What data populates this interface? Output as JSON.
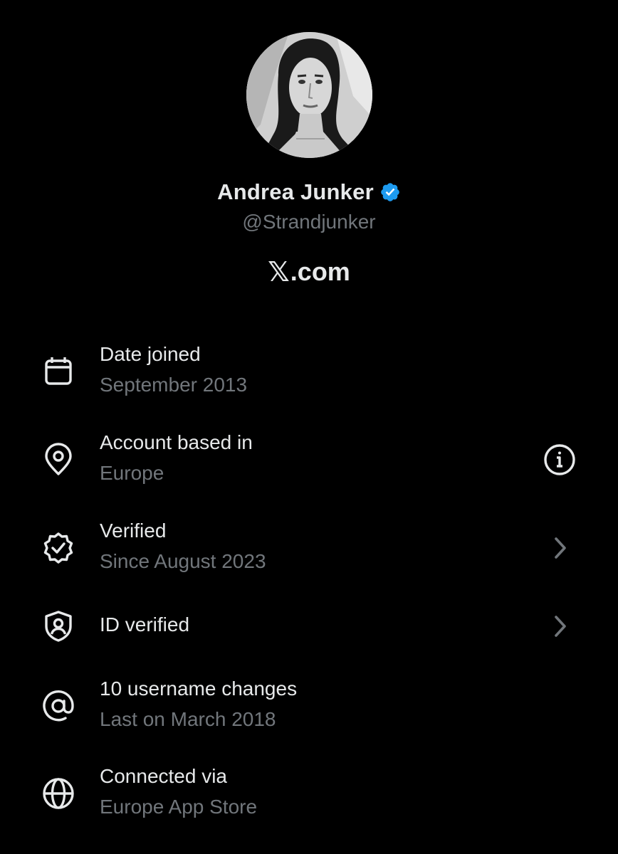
{
  "profile": {
    "display_name": "Andrea Junker",
    "handle": "@Strandjunker",
    "site_glyph": "𝕏",
    "site_suffix": ".com",
    "verified_badge_color": "#1d9bf0"
  },
  "about_rows": [
    {
      "icon": "calendar-icon",
      "title": "Date joined",
      "subtitle": "September 2013"
    },
    {
      "icon": "location-pin-icon",
      "title": "Account based in",
      "subtitle": "Europe",
      "trailing": "info-icon"
    },
    {
      "icon": "verified-seal-icon",
      "title": "Verified",
      "subtitle": "Since August 2023",
      "trailing": "chevron-right-icon"
    },
    {
      "icon": "id-shield-icon",
      "title": "ID verified",
      "trailing": "chevron-right-icon"
    },
    {
      "icon": "at-sign-icon",
      "title": "10 username changes",
      "subtitle": "Last on March 2018"
    },
    {
      "icon": "globe-icon",
      "title": "Connected via",
      "subtitle": "Europe App Store"
    }
  ],
  "colors": {
    "background": "#000000",
    "primary_text": "#e7e9ea",
    "secondary_text": "#71767b"
  }
}
